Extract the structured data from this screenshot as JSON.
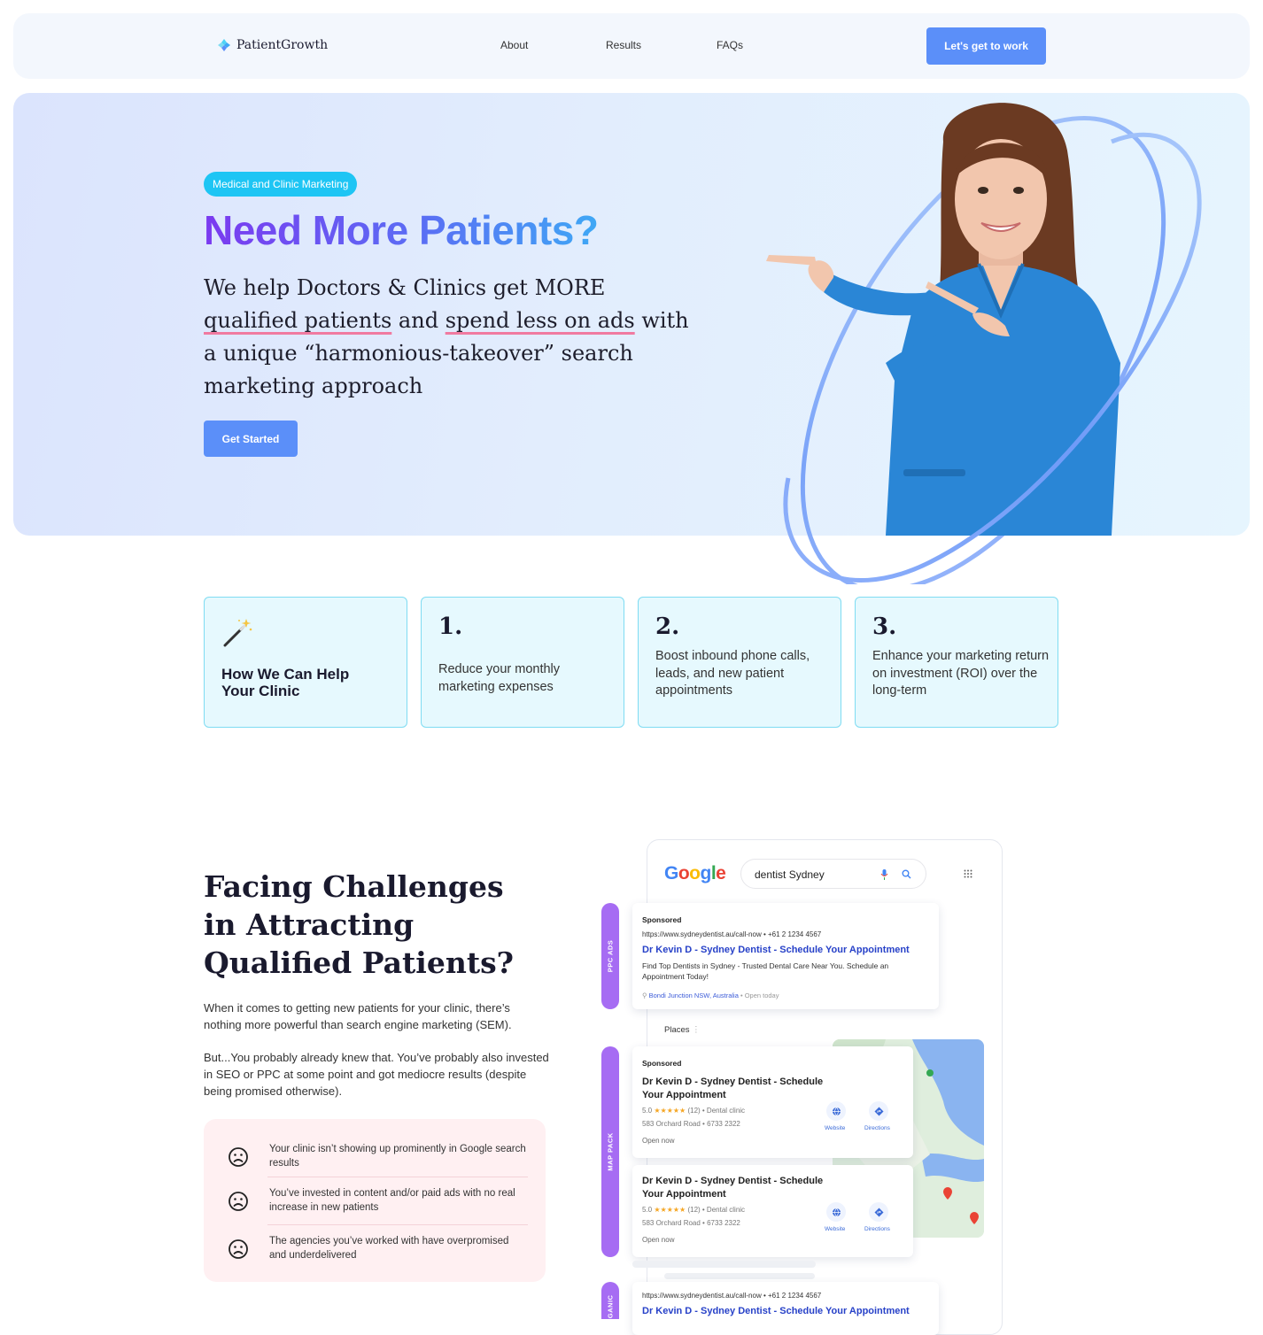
{
  "nav": {
    "brand": "PatientGrowth",
    "links": [
      "About",
      "Results",
      "FAQs"
    ],
    "cta": "Let's get to work"
  },
  "hero": {
    "pill": "Medical and Clinic Marketing",
    "title": "Need More Patients?",
    "lead": {
      "p1": "We help Doctors & Clinics get MORE ",
      "u1": "qualified patients",
      "p2": " and ",
      "u2": "spend less on ads",
      "p3": " with a unique “harmonious-takeover” search marketing approach"
    },
    "button": "Get Started"
  },
  "cards": {
    "intro": "How We Can Help Your Clinic",
    "items": [
      {
        "num": "1.",
        "text": "Reduce your monthly marketing expenses"
      },
      {
        "num": "2.",
        "text": "Boost inbound phone calls, leads, and new patient appointments"
      },
      {
        "num": "3.",
        "text": "Enhance your marketing return on investment (ROI) over the long-term"
      }
    ]
  },
  "challenges": {
    "title": "Facing Challenges in Attracting Qualified Patients?",
    "p1": "When it comes to getting new patients for your clinic, there’s nothing more powerful than search engine marketing (SEM).",
    "p2": "But...You probably already knew that. You’ve probably also invested in SEO or PPC at some point and got mediocre results (despite being promised otherwise).",
    "pains": [
      "Your clinic isn’t showing up prominently in Google search results",
      "You’ve invested in content and/or paid ads with no real increase in new patients",
      "The agencies you’ve worked with have overpromised and underdelivered"
    ]
  },
  "google": {
    "logo": "Google",
    "query": "dentist Sydney",
    "ppc_label": "PPC ADS",
    "map_label": "MAP PACK",
    "organic_label": "ORGANIC",
    "places": "Places",
    "ad": {
      "sponsored": "Sponsored",
      "url": "https://www.sydneydentist.au/call-now • +61 2 1234 4567",
      "title": "Dr Kevin D - Sydney Dentist - Schedule Your Appointment",
      "desc": "Find Top Dentists in Sydney - Trusted Dental Care Near You. Schedule an Appointment Today!",
      "loc": "Bondi Junction NSW, Australia",
      "loc_status": " • Open today"
    },
    "listing": {
      "sponsored": "Sponsored",
      "name": "Dr Kevin D - Sydney Dentist - Schedule Your Appointment",
      "rating": "5.0",
      "stars": "★★★★★",
      "meta": "(12) • Dental clinic",
      "address": "583 Orchard Road • 6733 2322",
      "open": "Open now",
      "website": "Website",
      "directions": "Directions"
    },
    "organic": {
      "url": "https://www.sydneydentist.au/call-now • +61 2 1234 4567",
      "title": "Dr Kevin D - Sydney Dentist - Schedule Your Appointment"
    }
  },
  "colors": {
    "accent": "#5b8ff9",
    "pill": "#1ec5f4",
    "card_border": "#7fdcf2",
    "label_purple": "#a66cf3"
  }
}
